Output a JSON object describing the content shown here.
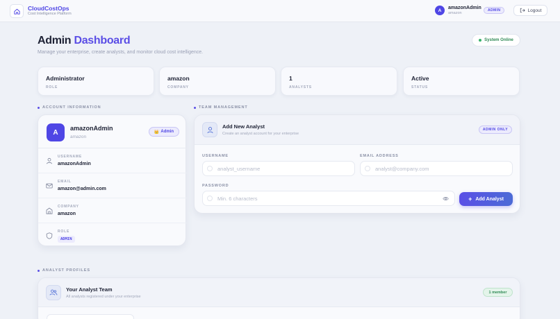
{
  "app": {
    "name": "CloudCostOps",
    "tagline": "Cost Intelligence Platform"
  },
  "user": {
    "initial": "A",
    "name": "amazonAdmin",
    "org": "amazon",
    "role_badge": "ADMIN",
    "logout_label": "Logout"
  },
  "header": {
    "title_part1": "Admin",
    "title_part2": "Dashboard",
    "subtitle": "Manage your enterprise, create analysts, and monitor cloud cost intelligence.",
    "status": "System Online"
  },
  "stats": [
    {
      "value": "Administrator",
      "label": "ROLE"
    },
    {
      "value": "amazon",
      "label": "COMPANY"
    },
    {
      "value": "1",
      "label": "ANALYSTS"
    },
    {
      "value": "Active",
      "label": "STATUS"
    }
  ],
  "account": {
    "section_label": "ACCOUNT INFORMATION",
    "initial": "A",
    "name": "amazonAdmin",
    "org": "amazon",
    "badge": "Admin",
    "badge_icon": "👑",
    "fields": [
      {
        "label": "USERNAME",
        "value": "amazonAdmin",
        "icon": "user-icon"
      },
      {
        "label": "EMAIL",
        "value": "amazon@admin.com",
        "icon": "mail-icon"
      },
      {
        "label": "COMPANY",
        "value": "amazon",
        "icon": "building-icon"
      },
      {
        "label": "ROLE",
        "value": "ADMIN",
        "icon": "shield-icon"
      }
    ]
  },
  "team": {
    "section_label": "TEAM MANAGEMENT",
    "card_title": "Add New Analyst",
    "card_subtitle": "Create an analyst account for your enterprise",
    "admin_only": "ADMIN ONLY",
    "username_label": "USERNAME",
    "username_placeholder": "analyst_username",
    "email_label": "EMAIL ADDRESS",
    "email_placeholder": "analyst@company.com",
    "password_label": "PASSWORD",
    "password_placeholder": "Min. 6 characters",
    "submit_label": "Add Analyst"
  },
  "profiles": {
    "section_label": "ANALYST PROFILES",
    "title": "Your Analyst Team",
    "subtitle": "All analysts registered under your enterprise",
    "member_count": "1 member"
  },
  "colors": {
    "accent": "#4f46e5",
    "success": "#2f8a55",
    "background": "#eef1f7"
  }
}
